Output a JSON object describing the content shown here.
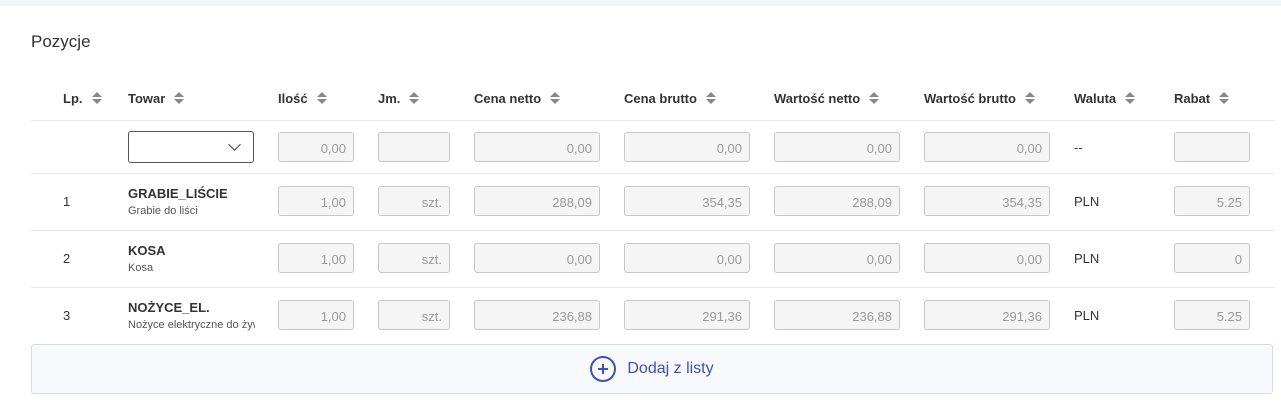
{
  "section": {
    "title": "Pozycje"
  },
  "columns": [
    {
      "key": "lp",
      "label": "Lp."
    },
    {
      "key": "towar",
      "label": "Towar"
    },
    {
      "key": "ilosc",
      "label": "Ilość"
    },
    {
      "key": "jm",
      "label": "Jm."
    },
    {
      "key": "cena_netto",
      "label": "Cena netto"
    },
    {
      "key": "cena_brutto",
      "label": "Cena brutto"
    },
    {
      "key": "wartosc_netto",
      "label": "Wartość netto"
    },
    {
      "key": "wartosc_brutto",
      "label": "Wartość brutto"
    },
    {
      "key": "waluta",
      "label": "Waluta"
    },
    {
      "key": "rabat",
      "label": "Rabat"
    }
  ],
  "new_row": {
    "towar_selected": "",
    "ilosc": "0,00",
    "jm": "",
    "cena_netto": "0,00",
    "cena_brutto": "0,00",
    "wartosc_netto": "0,00",
    "wartosc_brutto": "0,00",
    "waluta": "--",
    "rabat": ""
  },
  "rows": [
    {
      "lp": "1",
      "code": "GRABIE_LIŚCIE",
      "name": "Grabie do liści",
      "ilosc": "1,00",
      "jm": "szt.",
      "cena_netto": "288,09",
      "cena_brutto": "354,35",
      "wartosc_netto": "288,09",
      "wartosc_brutto": "354,35",
      "waluta": "PLN",
      "rabat": "5.25"
    },
    {
      "lp": "2",
      "code": "KOSA",
      "name": "Kosa",
      "ilosc": "1,00",
      "jm": "szt.",
      "cena_netto": "0,00",
      "cena_brutto": "0,00",
      "wartosc_netto": "0,00",
      "wartosc_brutto": "0,00",
      "waluta": "PLN",
      "rabat": "0"
    },
    {
      "lp": "3",
      "code": "NOŻYCE_EL.",
      "name": "Nożyce elektryczne do żywopłotu",
      "ilosc": "1,00",
      "jm": "szt.",
      "cena_netto": "236,88",
      "cena_brutto": "291,36",
      "wartosc_netto": "236,88",
      "wartosc_brutto": "291,36",
      "waluta": "PLN",
      "rabat": "5.25"
    }
  ],
  "add_button": {
    "label": "Dodaj z listy",
    "icon": "plus-circle-icon",
    "accent": "#3f51b5"
  }
}
